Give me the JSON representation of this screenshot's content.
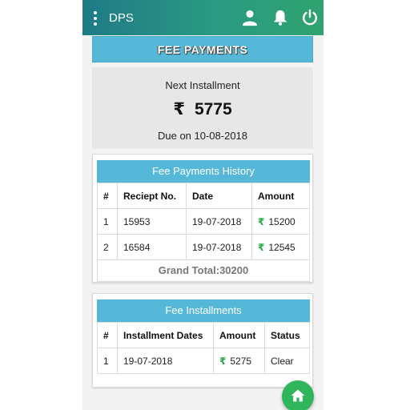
{
  "app": {
    "title": "DPS",
    "icons": [
      "menu-icon",
      "user-icon",
      "bell-icon",
      "power-icon"
    ]
  },
  "page": {
    "banner": "FEE PAYMENTS"
  },
  "next_installment": {
    "label": "Next Installment",
    "currency": "₹",
    "amount": "5775",
    "due_text": "Due on 10-08-2018"
  },
  "history": {
    "title": "Fee Payments History",
    "columns": [
      "#",
      "Reciept No.",
      "Date",
      "Amount"
    ],
    "rows": [
      {
        "num": "1",
        "receipt": "15953",
        "date": "19-07-2018",
        "currency": "₹",
        "amount": "15200"
      },
      {
        "num": "2",
        "receipt": "16584",
        "date": "19-07-2018",
        "currency": "₹",
        "amount": "12545"
      }
    ],
    "grand_total": "Grand Total:30200"
  },
  "installments": {
    "title": "Fee Installments",
    "columns": [
      "#",
      "Installment Dates",
      "Amount",
      "Status"
    ],
    "rows": [
      {
        "num": "1",
        "date": "19-07-2018",
        "currency": "₹",
        "amount": "5275",
        "status": "Clear"
      }
    ]
  },
  "colors": {
    "accent": "#56b8d8",
    "appbar_start": "#1f7a86",
    "appbar_end": "#2fa36f",
    "rupee_green": "#2aa84a",
    "fab": "#2fb65b"
  }
}
